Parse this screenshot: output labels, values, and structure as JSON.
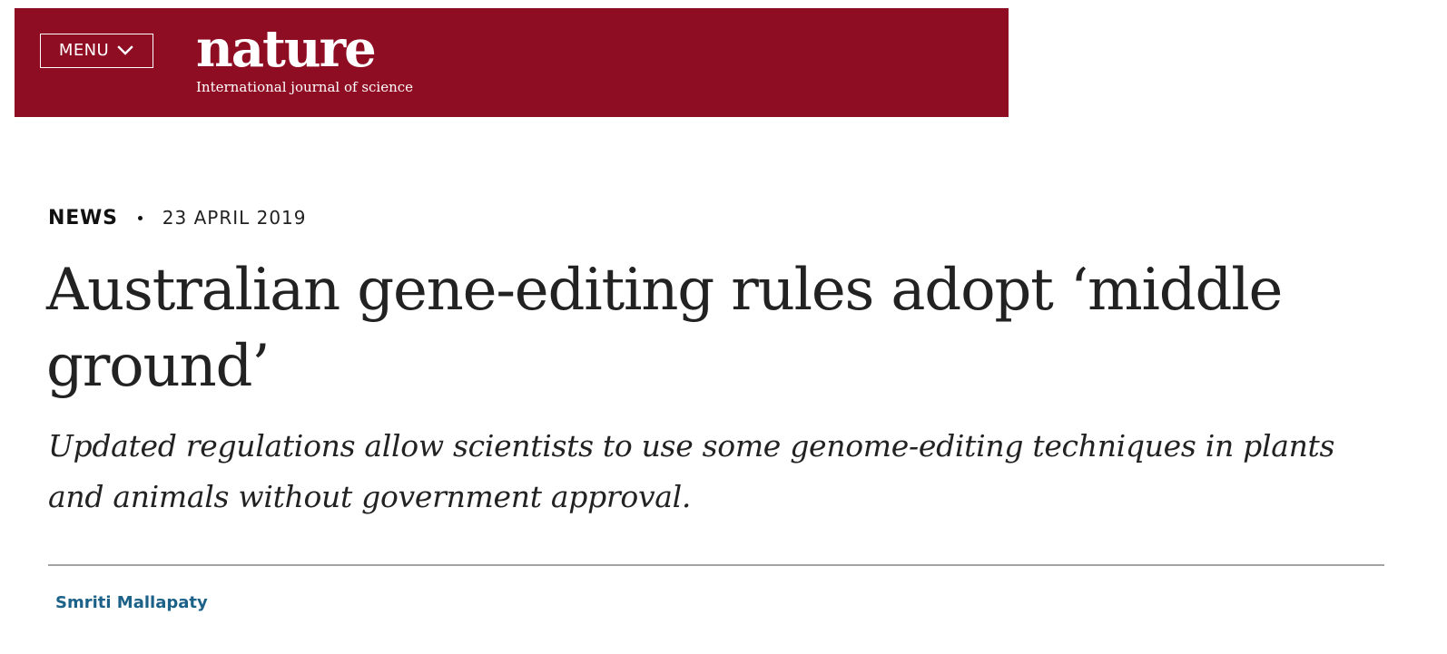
{
  "header": {
    "menu_label": "MENU",
    "menu_icon": "chevron-down-icon",
    "logo_text": "nature",
    "tagline": "International journal of science",
    "brand_color": "#8f0d23"
  },
  "article": {
    "type": "NEWS",
    "date": "23 APRIL 2019",
    "title": "Australian gene-editing rules adopt ‘middle ground’",
    "standfirst": "Updated regulations allow scientists to use some genome-editing techniques in plants and animals without government approval.",
    "author": "Smriti Mallapaty",
    "author_color": "#1b6188"
  }
}
